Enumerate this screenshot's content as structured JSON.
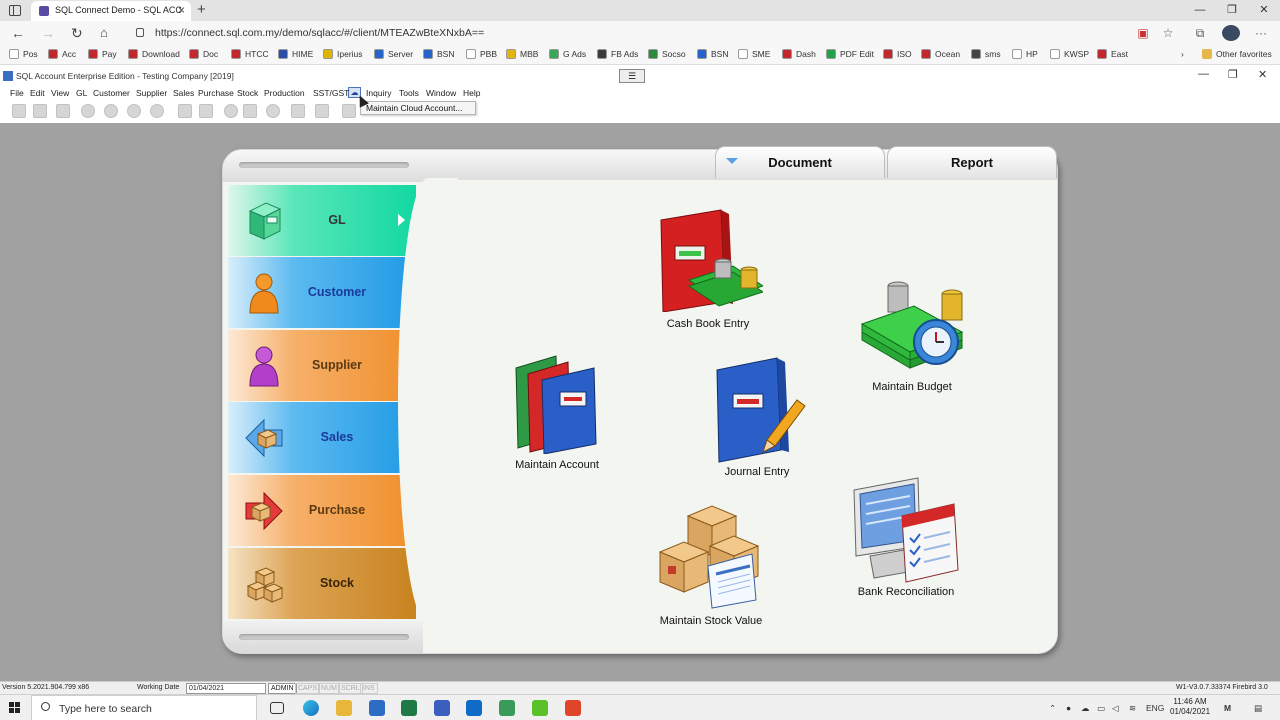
{
  "browser": {
    "tab_title": "SQL Connect Demo - SQL ACC",
    "url": "https://connect.sql.com.my/demo/sqlacc/#/client/MTEAZwBteXNxbA==",
    "favorites": [
      {
        "label": "Pos",
        "color": "#ffffff"
      },
      {
        "label": "Acc",
        "color": "#c4262e"
      },
      {
        "label": "Pay",
        "color": "#c4262e"
      },
      {
        "label": "Download",
        "color": "#c4262e"
      },
      {
        "label": "Doc",
        "color": "#c4262e"
      },
      {
        "label": "HTCC",
        "color": "#c4262e"
      },
      {
        "label": "HIME",
        "color": "#2a4fa8"
      },
      {
        "label": "Iperius",
        "color": "#e0b400"
      },
      {
        "label": "Server",
        "color": "#2563c9"
      },
      {
        "label": "BSN",
        "color": "#2563c9"
      },
      {
        "label": "PBB",
        "color": "#ffffff"
      },
      {
        "label": "MBB",
        "color": "#e3b410"
      },
      {
        "label": "G Ads",
        "color": "#3aa757"
      },
      {
        "label": "FB Ads",
        "color": "#3b3b3b"
      },
      {
        "label": "Socso",
        "color": "#2b8a3e"
      },
      {
        "label": "BSN",
        "color": "#2563c9"
      },
      {
        "label": "SME",
        "color": "#ffffff"
      },
      {
        "label": "Dash",
        "color": "#c4262e"
      },
      {
        "label": "PDF Edit",
        "color": "#1fa34a"
      },
      {
        "label": "ISO",
        "color": "#c4262e"
      },
      {
        "label": "Ocean",
        "color": "#c4262e"
      },
      {
        "label": "sms",
        "color": "#444444"
      },
      {
        "label": "HP",
        "color": "#ffffff"
      },
      {
        "label": "KWSP",
        "color": "#ffffff"
      },
      {
        "label": "East",
        "color": "#c4262e"
      }
    ],
    "other_favorites": "Other favorites"
  },
  "app": {
    "title": "SQL Account Enterprise Edition - Testing Company [2019]",
    "menu": [
      "File",
      "Edit",
      "View",
      "GL",
      "Customer",
      "Supplier",
      "Sales",
      "Purchase",
      "Stock",
      "Production",
      "SST/GST",
      "Inquiry",
      "Tools",
      "Window",
      "Help"
    ],
    "dropdown_item": "Maintain Cloud Account..."
  },
  "panel": {
    "tabs": [
      {
        "label": "Document",
        "active": true
      },
      {
        "label": "Report",
        "active": false
      }
    ],
    "nav": [
      {
        "label": "GL",
        "icon": "gl-cabinet-icon"
      },
      {
        "label": "Customer",
        "icon": "customer-person-icon"
      },
      {
        "label": "Supplier",
        "icon": "supplier-person-icon"
      },
      {
        "label": "Sales",
        "icon": "sales-arrow-box-icon"
      },
      {
        "label": "Purchase",
        "icon": "purchase-arrow-box-icon"
      },
      {
        "label": "Stock",
        "icon": "stock-boxes-icon"
      }
    ],
    "items": [
      {
        "label": "Cash Book Entry",
        "icon": "cash-book-icon"
      },
      {
        "label": "Maintain Budget",
        "icon": "budget-money-clock-icon"
      },
      {
        "label": "Maintain Account",
        "icon": "account-binders-icon"
      },
      {
        "label": "Journal Entry",
        "icon": "journal-book-pencil-icon"
      },
      {
        "label": "Maintain Stock Value",
        "icon": "stock-value-boxes-icon"
      },
      {
        "label": "Bank Reconciliation",
        "icon": "bank-reconciliation-icon"
      }
    ]
  },
  "statusbar": {
    "version": "Version 5.2021.904.799 x86",
    "working_date_label": "Working Date",
    "working_date": "01/04/2021",
    "user": "ADMIN",
    "caps": "CAPS",
    "num": "NUM",
    "scrl": "SCRL",
    "ins": "INS",
    "build": "W1-V3.0.7.33374 Firebird 3.0"
  },
  "taskbar": {
    "search_placeholder": "Type here to search",
    "lang": "ENG",
    "time": "11:46 AM",
    "date": "01/04/2021"
  }
}
